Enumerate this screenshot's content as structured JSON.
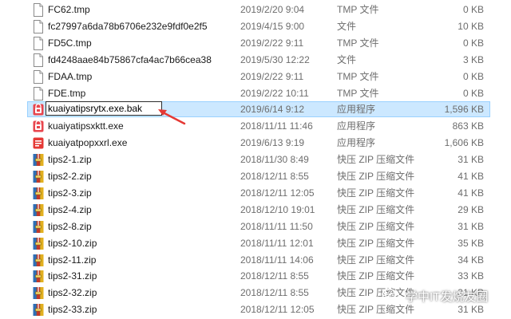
{
  "files": [
    {
      "name": "FC62.tmp",
      "date": "2019/2/20 9:04",
      "type": "TMP 文件",
      "size": "0 KB",
      "icon": "blank-file-icon"
    },
    {
      "name": "fc27997a6da78b6706e232e9fdf0e2f5",
      "date": "2019/4/15 9:00",
      "type": "文件",
      "size": "10 KB",
      "icon": "blank-file-icon"
    },
    {
      "name": "FD5C.tmp",
      "date": "2019/2/22 9:11",
      "type": "TMP 文件",
      "size": "0 KB",
      "icon": "blank-file-icon"
    },
    {
      "name": "fd4248aae84b75867cfa4ac7b66cea38",
      "date": "2019/5/30 12:22",
      "type": "文件",
      "size": "3 KB",
      "icon": "blank-file-icon"
    },
    {
      "name": "FDAA.tmp",
      "date": "2019/2/22 9:11",
      "type": "TMP 文件",
      "size": "0 KB",
      "icon": "blank-file-icon"
    },
    {
      "name": "FDE.tmp",
      "date": "2019/2/22 10:11",
      "type": "TMP 文件",
      "size": "0 KB",
      "icon": "blank-file-icon"
    },
    {
      "name": "kuaiyatipsrytx.exe.bak",
      "date": "2019/6/14 9:12",
      "type": "应用程序",
      "size": "1,596 KB",
      "icon": "app-bag-icon",
      "selected": true,
      "renaming": true
    },
    {
      "name": "kuaiyatipsxktt.exe",
      "date": "2018/11/11 11:46",
      "type": "应用程序",
      "size": "863 KB",
      "icon": "app-bag-icon"
    },
    {
      "name": "kuaiyatpopxxrl.exe",
      "date": "2019/6/13 9:19",
      "type": "应用程序",
      "size": "1,606 KB",
      "icon": "app-popup-icon"
    },
    {
      "name": "tips2-1.zip",
      "date": "2018/11/30 8:49",
      "type": "快压 ZIP 压缩文件",
      "size": "31 KB",
      "icon": "zip-archive-icon"
    },
    {
      "name": "tips2-2.zip",
      "date": "2018/12/11 8:55",
      "type": "快压 ZIP 压缩文件",
      "size": "41 KB",
      "icon": "zip-archive-icon"
    },
    {
      "name": "tips2-3.zip",
      "date": "2018/12/11 12:05",
      "type": "快压 ZIP 压缩文件",
      "size": "41 KB",
      "icon": "zip-archive-icon"
    },
    {
      "name": "tips2-4.zip",
      "date": "2018/12/10 19:01",
      "type": "快压 ZIP 压缩文件",
      "size": "29 KB",
      "icon": "zip-archive-icon"
    },
    {
      "name": "tips2-8.zip",
      "date": "2018/11/11 11:50",
      "type": "快压 ZIP 压缩文件",
      "size": "31 KB",
      "icon": "zip-archive-icon"
    },
    {
      "name": "tips2-10.zip",
      "date": "2018/11/11 12:01",
      "type": "快压 ZIP 压缩文件",
      "size": "35 KB",
      "icon": "zip-archive-icon"
    },
    {
      "name": "tips2-11.zip",
      "date": "2018/11/11 14:06",
      "type": "快压 ZIP 压缩文件",
      "size": "34 KB",
      "icon": "zip-archive-icon"
    },
    {
      "name": "tips2-31.zip",
      "date": "2018/12/11 8:55",
      "type": "快压 ZIP 压缩文件",
      "size": "33 KB",
      "icon": "zip-archive-icon"
    },
    {
      "name": "tips2-32.zip",
      "date": "2018/12/11 8:55",
      "type": "快压 ZIP 压缩文件",
      "size": "31 KB",
      "icon": "zip-archive-icon"
    },
    {
      "name": "tips2-33.zip",
      "date": "2018/12/11 12:05",
      "type": "快压 ZIP 压缩文件",
      "size": "31 KB",
      "icon": "zip-archive-icon"
    }
  ],
  "watermark": {
    "text": "学中IT发烧友圈",
    "icon": "wechat-icon"
  },
  "colors": {
    "selection_fill": "#cce8ff",
    "selection_border": "#99d1ff",
    "arrow": "#e53935",
    "secondary_text": "#6d6d6d"
  }
}
